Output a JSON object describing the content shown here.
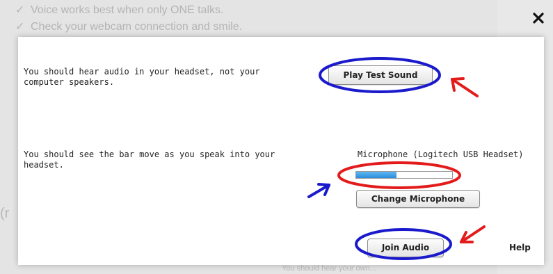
{
  "background": {
    "lines": [
      "Voice works best when only ONE talks.",
      "Check your webcam connection and smile."
    ],
    "fragment": "(r",
    "bottom_text": "You should hear your own..."
  },
  "dialog": {
    "audio_instruction": "You should hear audio in your headset, not your computer speakers.",
    "play_test_sound_label": "Play Test Sound",
    "mic_instruction": "You should see the bar move as you speak into your headset.",
    "microphone_name": "Microphone (Logitech USB Headset)",
    "mic_level": 0.42,
    "change_microphone_label": "Change Microphone",
    "join_audio_label": "Join Audio",
    "help_label": "Help",
    "close_label": "×"
  },
  "annotation_colors": {
    "blue": "#1a1acc",
    "red": "#e31b1b"
  }
}
